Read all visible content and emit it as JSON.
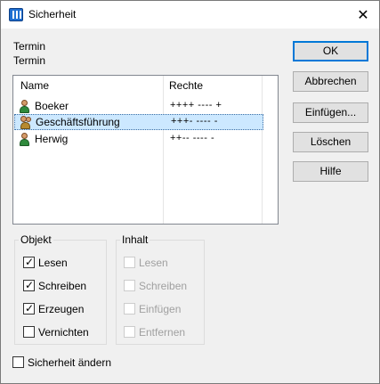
{
  "window": {
    "title": "Sicherheit",
    "close_glyph": "✕"
  },
  "labels": {
    "line1": "Termin",
    "line2": "Termin"
  },
  "list": {
    "columns": [
      "Name",
      "Rechte"
    ],
    "rows": [
      {
        "name": "Boeker",
        "rights": "++++ ---- +",
        "icon": "user-icon",
        "selected": false
      },
      {
        "name": "Geschäftsführung",
        "rights": "+++- ---- -",
        "icon": "group-icon",
        "selected": true
      },
      {
        "name": "Herwig",
        "rights": "++-- ---- -",
        "icon": "user-icon",
        "selected": false
      }
    ]
  },
  "buttons": {
    "ok": "OK",
    "cancel": "Abbrechen",
    "insert": "Einfügen...",
    "delete": "Löschen",
    "help": "Hilfe"
  },
  "objekt": {
    "title": "Objekt",
    "items": [
      {
        "label": "Lesen",
        "checked": true
      },
      {
        "label": "Schreiben",
        "checked": true
      },
      {
        "label": "Erzeugen",
        "checked": true
      },
      {
        "label": "Vernichten",
        "checked": false
      }
    ]
  },
  "inhalt": {
    "title": "Inhalt",
    "items": [
      {
        "label": "Lesen",
        "checked": false,
        "disabled": true
      },
      {
        "label": "Schreiben",
        "checked": false,
        "disabled": true
      },
      {
        "label": "Einfügen",
        "checked": false,
        "disabled": true
      },
      {
        "label": "Entfernen",
        "checked": false,
        "disabled": true
      }
    ]
  },
  "security_change": {
    "label": "Sicherheit ändern",
    "checked": false
  },
  "colors": {
    "selection": "#cce8ff",
    "default_button_border": "#0078d7"
  }
}
